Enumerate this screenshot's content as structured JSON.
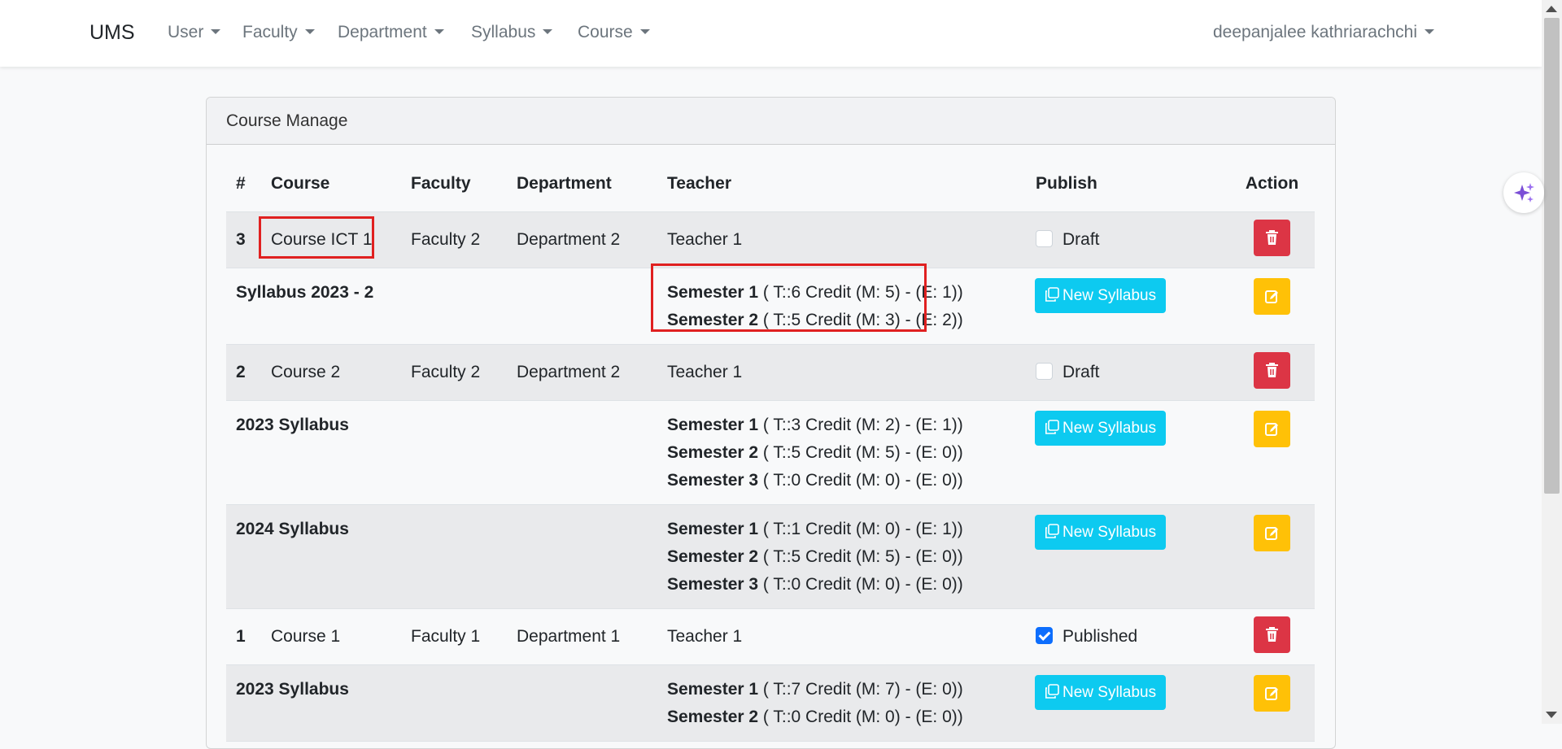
{
  "nav": {
    "brand": "UMS",
    "items": [
      {
        "label": "User"
      },
      {
        "label": "Faculty"
      },
      {
        "label": "Department"
      },
      {
        "label": "Syllabus"
      },
      {
        "label": "Course"
      }
    ],
    "user": "deepanjalee kathriarachchi"
  },
  "card": {
    "title": "Course Manage",
    "headers": [
      "#",
      "Course",
      "Faculty",
      "Department",
      "Teacher",
      "Publish",
      "Action"
    ],
    "new_syllabus_label": "New Syllabus",
    "courses": [
      {
        "num": "3",
        "course": "Course ICT 1",
        "faculty": "Faculty 2",
        "department": "Department 2",
        "teacher": "Teacher 1",
        "publish": "Draft",
        "published": false,
        "syllabi": [
          {
            "name": "Syllabus 2023 - 2",
            "semesters": [
              {
                "label": "Semester 1",
                "detail": "( T::6 Credit (M: 5) - (E: 1))"
              },
              {
                "label": "Semester 2",
                "detail": "( T::5 Credit (M: 3) - (E: 2))"
              }
            ]
          }
        ]
      },
      {
        "num": "2",
        "course": "Course 2",
        "faculty": "Faculty 2",
        "department": "Department 2",
        "teacher": "Teacher 1",
        "publish": "Draft",
        "published": false,
        "syllabi": [
          {
            "name": "2023 Syllabus",
            "semesters": [
              {
                "label": "Semester 1",
                "detail": "( T::3 Credit (M: 2) - (E: 1))"
              },
              {
                "label": "Semester 2",
                "detail": "( T::5 Credit (M: 5) - (E: 0))"
              },
              {
                "label": "Semester 3",
                "detail": "( T::0 Credit (M: 0) - (E: 0))"
              }
            ]
          },
          {
            "name": "2024 Syllabus",
            "semesters": [
              {
                "label": "Semester 1",
                "detail": "( T::1 Credit (M: 0) - (E: 1))"
              },
              {
                "label": "Semester 2",
                "detail": "( T::5 Credit (M: 5) - (E: 0))"
              },
              {
                "label": "Semester 3",
                "detail": "( T::0 Credit (M: 0) - (E: 0))"
              }
            ]
          }
        ]
      },
      {
        "num": "1",
        "course": "Course 1",
        "faculty": "Faculty 1",
        "department": "Department 1",
        "teacher": "Teacher 1",
        "publish": "Published",
        "published": true,
        "syllabi": [
          {
            "name": "2023 Syllabus",
            "semesters": [
              {
                "label": "Semester 1",
                "detail": "( T::7 Credit (M: 7) - (E: 0))"
              },
              {
                "label": "Semester 2",
                "detail": "( T::0 Credit (M: 0) - (E: 0))"
              }
            ]
          }
        ]
      }
    ]
  },
  "colors": {
    "info": "#0dcaf0",
    "danger": "#dc3545",
    "warning": "#ffc107",
    "primary": "#0d6efd",
    "highlight": "#e02020"
  }
}
